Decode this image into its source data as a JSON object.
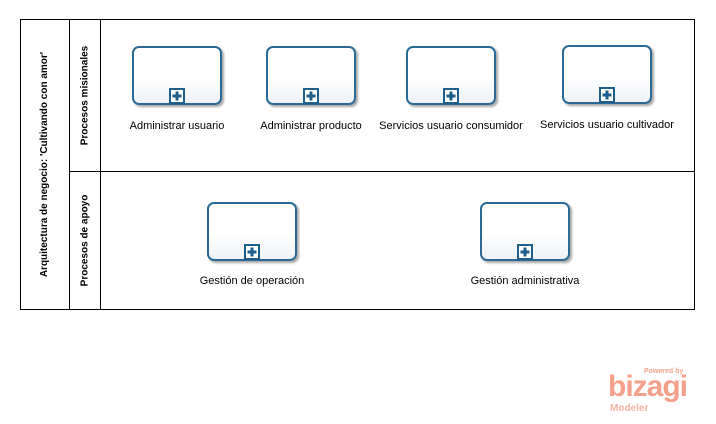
{
  "pool": {
    "label": "Arquitectura de negocio: 'Cultivando con amor'"
  },
  "lanes": [
    {
      "label": "Procesos misionales",
      "tasks": [
        {
          "label": "Administrar usuario",
          "icon": "plus-icon"
        },
        {
          "label": "Administrar producto",
          "icon": "plus-icon"
        },
        {
          "label": "Servicios usuario consumidor",
          "icon": "plus-icon"
        },
        {
          "label": "Servicios usuario cultivador",
          "icon": "plus-icon"
        }
      ]
    },
    {
      "label": "Procesos de apoyo",
      "tasks": [
        {
          "label": "Gestión de operación",
          "icon": "plus-icon"
        },
        {
          "label": "Gestión administrativa",
          "icon": "plus-icon"
        }
      ]
    }
  ],
  "logo": {
    "powered": "Powered by",
    "brand": "bizagi",
    "product": "Modeler",
    "color": "#f4a08a"
  },
  "colors": {
    "task_border": "#2a6a95",
    "marker_border": "#1d5f8a"
  }
}
